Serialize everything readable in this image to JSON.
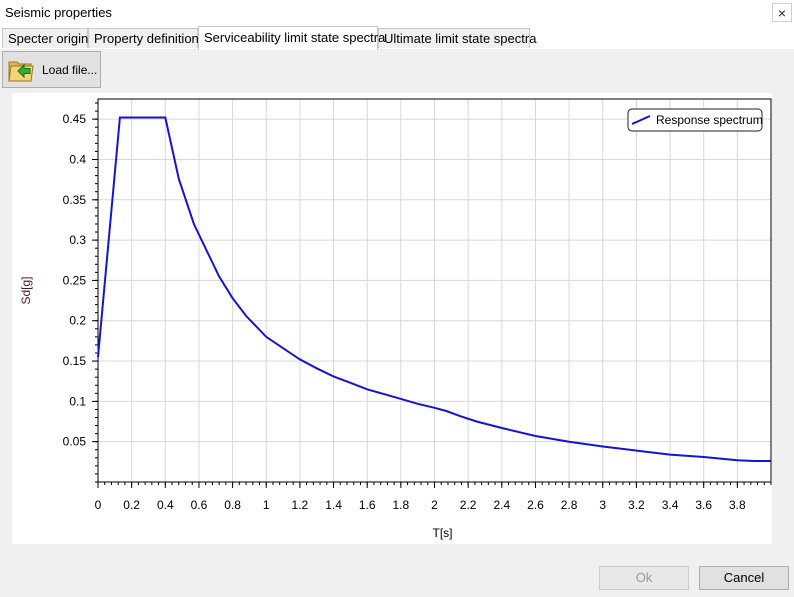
{
  "window": {
    "title": "Seismic properties",
    "close_glyph": "×"
  },
  "tabs": [
    {
      "label": "Specter origin",
      "active": false
    },
    {
      "label": "Property definition",
      "active": false
    },
    {
      "label": "Serviceability limit state spectra",
      "active": true
    },
    {
      "label": "Ultimate limit state spectra",
      "active": false
    }
  ],
  "toolbar": {
    "load_label": "Load file...",
    "load_icon": "folder-arrow-icon"
  },
  "buttons": {
    "ok_label": "Ok",
    "ok_enabled": false,
    "cancel_label": "Cancel"
  },
  "colors": {
    "series": "#1414d6",
    "axis_label": "#4b1a1a",
    "grid": "#d8d8d8"
  },
  "chart_data": {
    "type": "line",
    "xlabel": "T[s]",
    "ylabel": "Sd[g]",
    "xlim": [
      0,
      4.0
    ],
    "ylim": [
      0,
      0.475
    ],
    "xticks": [
      "0",
      "0.2",
      "0.4",
      "0.6",
      "0.8",
      "1",
      "1.2",
      "1.4",
      "1.6",
      "1.8",
      "2",
      "2.2",
      "2.4",
      "2.6",
      "2.8",
      "3",
      "3.2",
      "3.4",
      "3.6",
      "3.8"
    ],
    "yticks": [
      "0.05",
      "0.1",
      "0.15",
      "0.2",
      "0.25",
      "0.3",
      "0.35",
      "0.4",
      "0.45"
    ],
    "grid": true,
    "legend_position": "top-right",
    "series": [
      {
        "name": "Response spectrum",
        "x": [
          0,
          0.13,
          0.2,
          0.3,
          0.4,
          0.48,
          0.57,
          0.65,
          0.72,
          0.8,
          0.88,
          1.0,
          1.1,
          1.2,
          1.3,
          1.4,
          1.5,
          1.6,
          1.7,
          1.8,
          1.9,
          2.0,
          2.07,
          2.15,
          2.25,
          2.4,
          2.6,
          2.8,
          3.0,
          3.2,
          3.4,
          3.6,
          3.8,
          3.9,
          4.0
        ],
        "y": [
          0.155,
          0.452,
          0.452,
          0.452,
          0.452,
          0.376,
          0.32,
          0.285,
          0.255,
          0.228,
          0.206,
          0.18,
          0.166,
          0.152,
          0.141,
          0.131,
          0.123,
          0.115,
          0.109,
          0.103,
          0.097,
          0.092,
          0.088,
          0.082,
          0.075,
          0.067,
          0.057,
          0.05,
          0.044,
          0.039,
          0.034,
          0.031,
          0.027,
          0.026,
          0.026
        ]
      }
    ]
  }
}
